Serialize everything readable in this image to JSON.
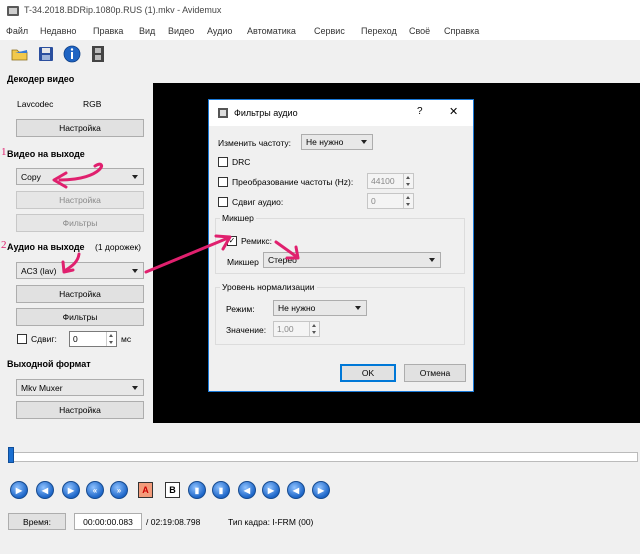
{
  "window": {
    "title": "T-34.2018.BDRip.1080p.RUS (1).mkv - Avidemux"
  },
  "menu": [
    "Файл",
    "Недавно",
    "Правка",
    "Вид",
    "Видео",
    "Аудио",
    "Автоматика",
    "Сервис",
    "Переход",
    "Своё",
    "Справка"
  ],
  "toolbar": {
    "icons": [
      "open-folder-icon",
      "save-disk-icon",
      "info-icon",
      "film-strip-icon"
    ]
  },
  "left_panel": {
    "video_decoder": {
      "title": "Декодер видео",
      "codec": "Lavcodec",
      "format": "RGB",
      "settings_button": "Настройка"
    },
    "video_output": {
      "number": "1",
      "title": "Видео на выходе",
      "codec_value": "Copy",
      "settings_button": "Настройка",
      "filters_button": "Фильтры"
    },
    "audio_output": {
      "number": "2",
      "title": "Аудио на выходе",
      "tracks_note": "(1 дорожек)",
      "codec_value": "AC3 (lav)",
      "settings_button": "Настройка",
      "filters_button": "Фильтры",
      "shift_label": "Сдвиг:",
      "shift_value": "0",
      "shift_unit": "мс"
    },
    "output_format": {
      "title": "Выходной формат",
      "muxer_value": "Mkv Muxer",
      "settings_button": "Настройка"
    }
  },
  "dialog": {
    "title": "Фильтры аудио",
    "help": "?",
    "close": "✕",
    "change_rate_label": "Изменить частоту:",
    "change_rate_value": "Не нужно",
    "drc_label": "DRC",
    "resample_label": "Преобразование частоты (Hz):",
    "resample_value": "44100",
    "shift_label": "Сдвиг аудио:",
    "shift_value": "0",
    "mixer_group": {
      "title": "Микшер",
      "remix_label": "Ремикс:",
      "remix_checked": true,
      "mixer_label": "Микшер",
      "mixer_value": "Стерео"
    },
    "normalize_group": {
      "title": "Уровень нормализации",
      "mode_label": "Режим:",
      "mode_value": "Не нужно",
      "value_label": "Значение:",
      "value_value": "1,00"
    },
    "ok_button": "OK",
    "cancel_button": "Отмена"
  },
  "timeline": {
    "position": 0.0
  },
  "transport": {
    "buttons": [
      "play",
      "previous",
      "next",
      "rewind",
      "fast-forward",
      "mark-a",
      "mark-b",
      "go-to-a",
      "go-to-b",
      "previous-keyframe",
      "next-keyframe",
      "previous-black",
      "next-black"
    ],
    "mark_a": "A",
    "mark_b": "B"
  },
  "status": {
    "time_button": "Время:",
    "current_time": "00:00:00.083",
    "total_time": "/ 02:19:08.798",
    "frame_type": "Тип кадра:  I-FRM (00)"
  },
  "colors": {
    "annotation": "#e0206e",
    "dialog_border": "#1a79d7",
    "video_bg": "#000000"
  }
}
